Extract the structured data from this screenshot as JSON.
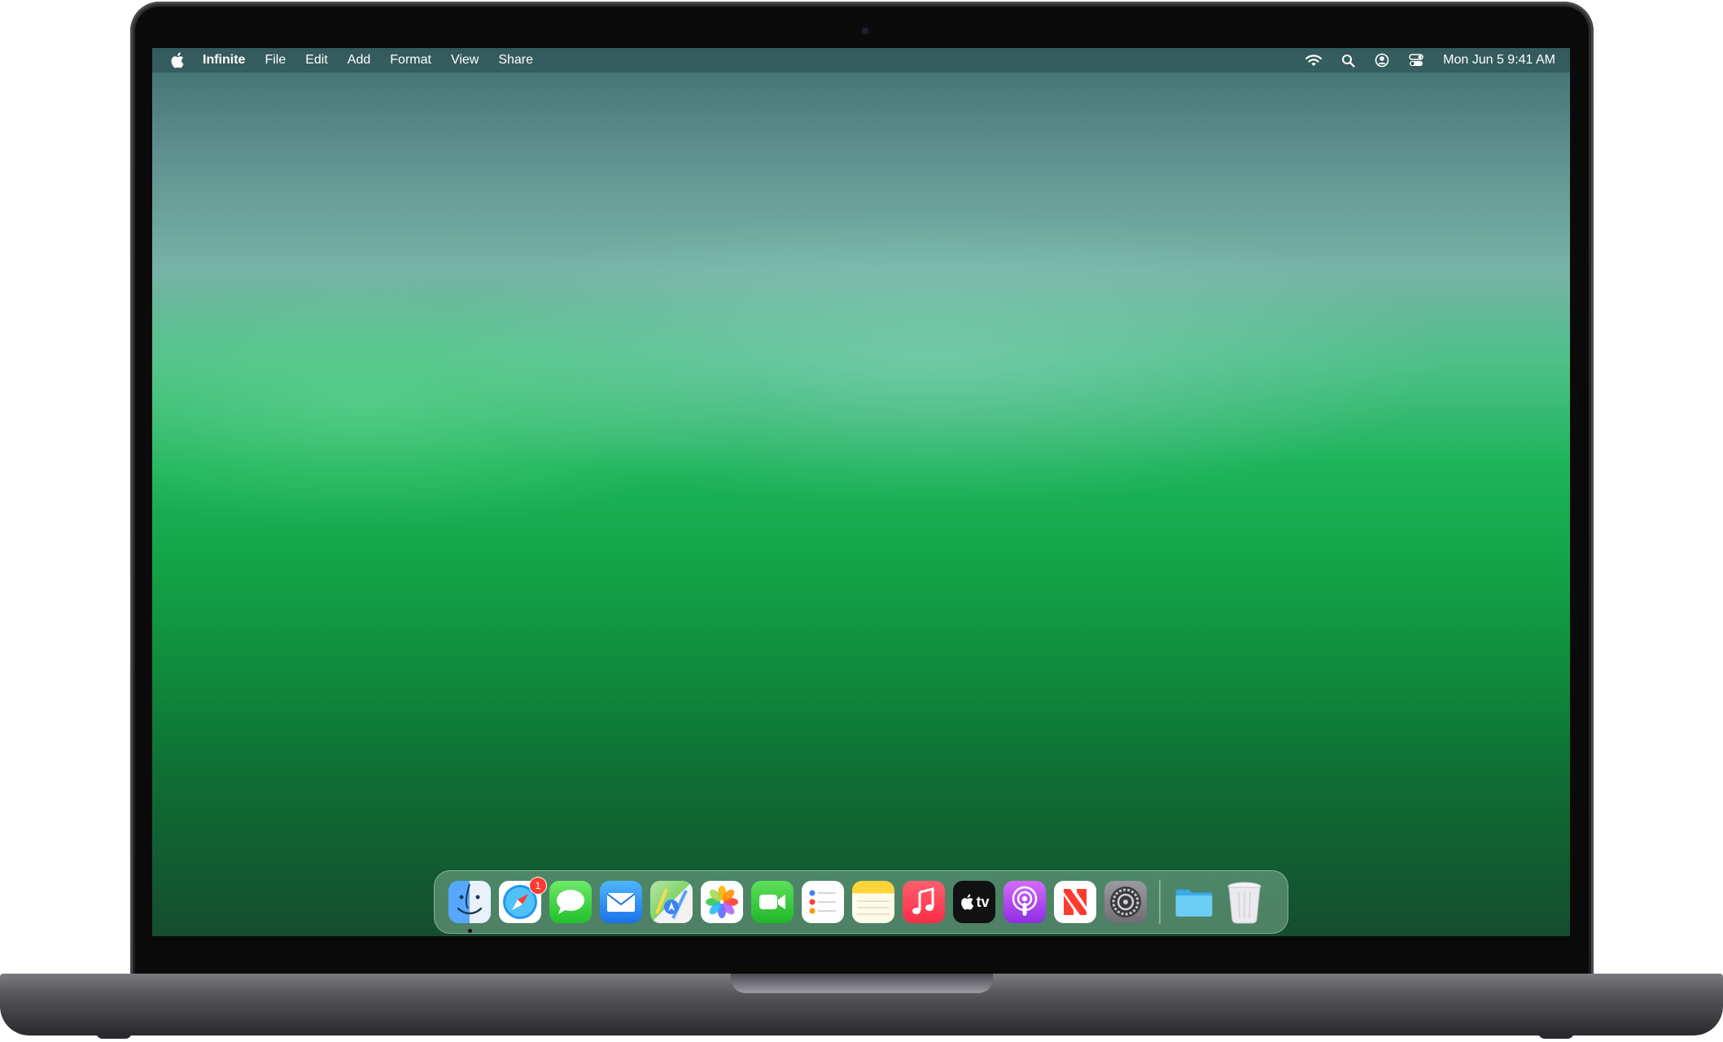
{
  "menubar": {
    "app_name": "Infinite",
    "menus": [
      "File",
      "Edit",
      "Add",
      "Format",
      "View",
      "Share"
    ],
    "clock": "Mon Jun 5  9:41 AM"
  },
  "dock": {
    "apps": [
      {
        "name": "Finder",
        "icon": "finder-icon",
        "running": true
      },
      {
        "name": "Safari",
        "icon": "safari-icon",
        "badge": "1"
      },
      {
        "name": "Messages",
        "icon": "messages-icon"
      },
      {
        "name": "Mail",
        "icon": "mail-icon"
      },
      {
        "name": "Maps",
        "icon": "maps-icon"
      },
      {
        "name": "Photos",
        "icon": "photos-icon"
      },
      {
        "name": "FaceTime",
        "icon": "facetime-icon"
      },
      {
        "name": "Reminders",
        "icon": "reminders-icon"
      },
      {
        "name": "Notes",
        "icon": "notes-icon"
      },
      {
        "name": "Music",
        "icon": "music-icon"
      },
      {
        "name": "TV",
        "icon": "tv-icon",
        "label": "tv"
      },
      {
        "name": "Podcasts",
        "icon": "podcasts-icon"
      },
      {
        "name": "News",
        "icon": "news-icon"
      },
      {
        "name": "System Settings",
        "icon": "settings-icon"
      }
    ],
    "extras": [
      {
        "name": "Folder",
        "icon": "folder-icon"
      },
      {
        "name": "Trash",
        "icon": "trash-icon"
      }
    ]
  },
  "colors": {
    "badge": "#ff3b30",
    "wallpaper_top": "#3f6f70",
    "wallpaper_mid": "#1db45a",
    "wallpaper_bottom": "#154d2f"
  }
}
